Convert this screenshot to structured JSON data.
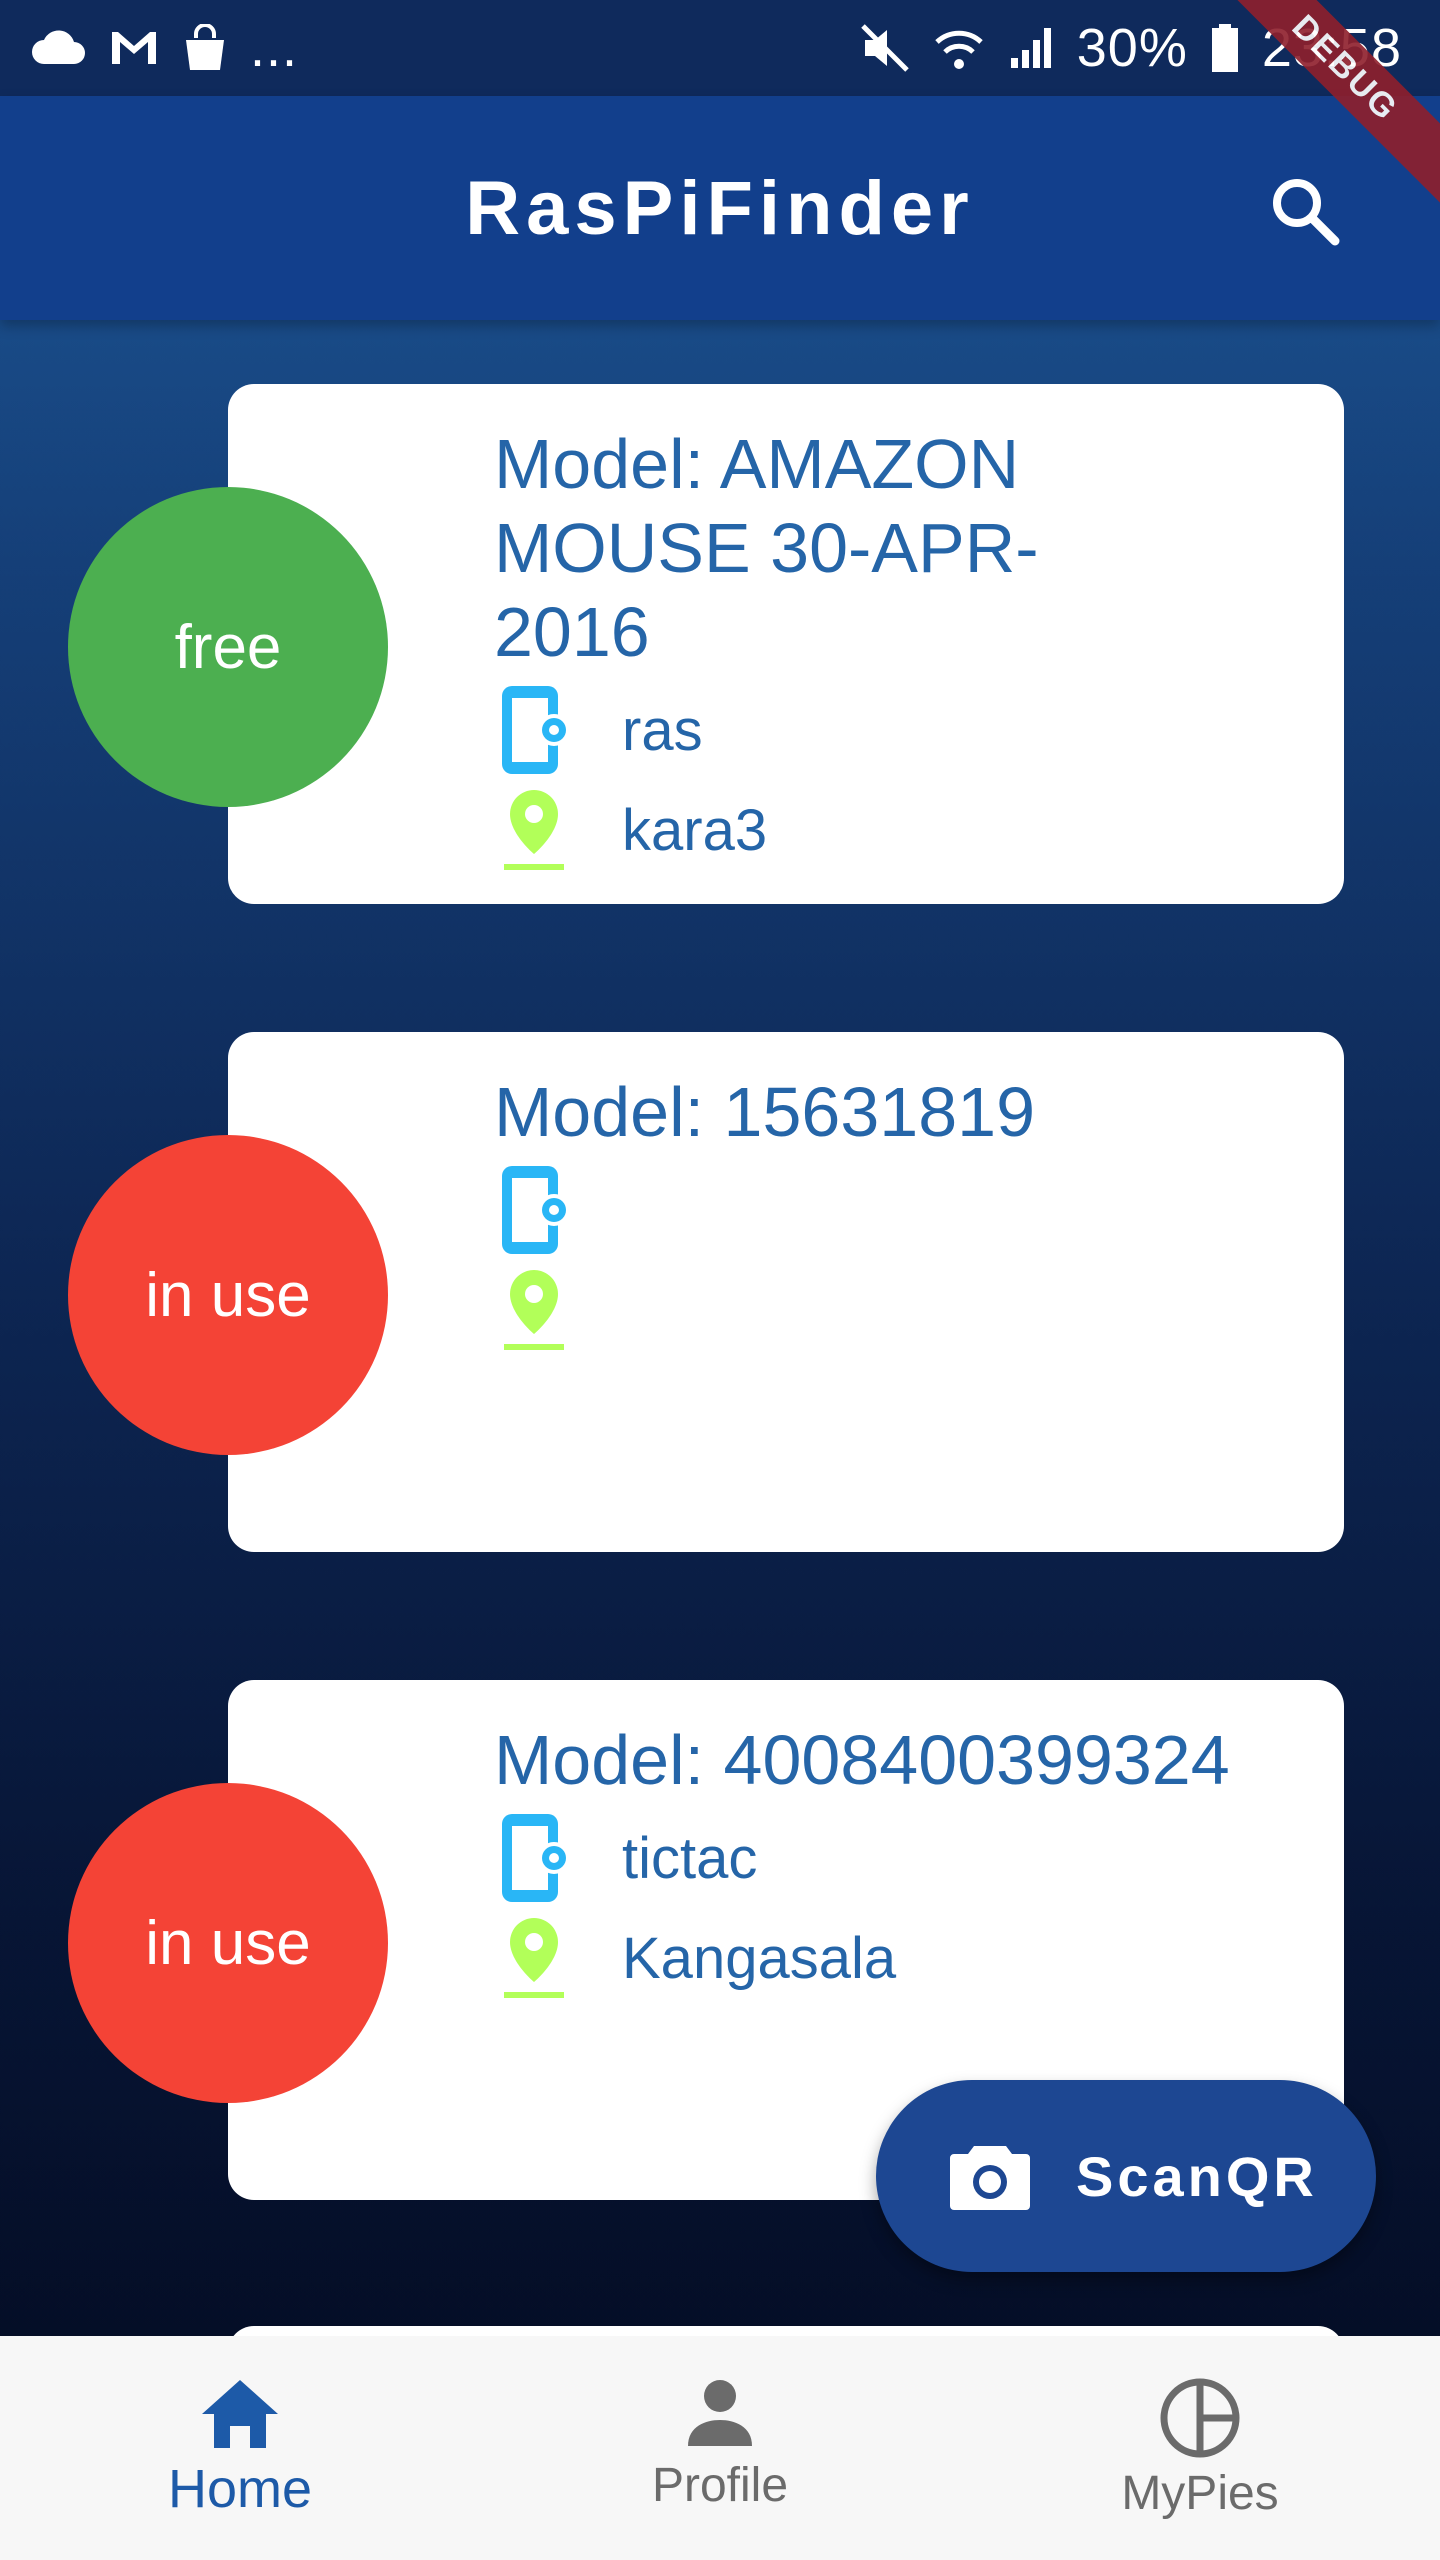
{
  "status_bar": {
    "left_icons": [
      "cloud-icon",
      "gmail-icon",
      "shopping-bag-icon"
    ],
    "more": "...",
    "right_icons": [
      "mute-icon",
      "wifi-icon",
      "signal-icon"
    ],
    "battery": "30%",
    "time": "23:58"
  },
  "debug_banner": "DEBUG",
  "app_bar": {
    "title": "RasPiFinder",
    "search_icon": "search-icon"
  },
  "devices": [
    {
      "status": "free",
      "status_color": "#4caf50",
      "model": "Model: AMAZON MOUSE 30-APR-2016",
      "name": "ras",
      "location": "kara3"
    },
    {
      "status": "in use",
      "status_color": "#f44336",
      "model": "Model: 15631819",
      "name": "",
      "location": ""
    },
    {
      "status": "in use",
      "status_color": "#f44336",
      "model": "Model: 4008400399324",
      "name": "tictac",
      "location": "Kangasala"
    }
  ],
  "fab": {
    "label": "ScanQR",
    "icon": "camera-icon"
  },
  "bottom_nav": {
    "items": [
      {
        "label": "Home",
        "icon": "home-icon",
        "active": true
      },
      {
        "label": "Profile",
        "icon": "person-icon",
        "active": false
      },
      {
        "label": "MyPies",
        "icon": "pie-icon",
        "active": false
      }
    ]
  },
  "colors": {
    "primary": "#123f8c",
    "text_blue": "#2565a8",
    "device_icon": "#29b6f6",
    "location_icon": "#b2ff59",
    "free": "#4caf50",
    "in_use": "#f44336"
  }
}
